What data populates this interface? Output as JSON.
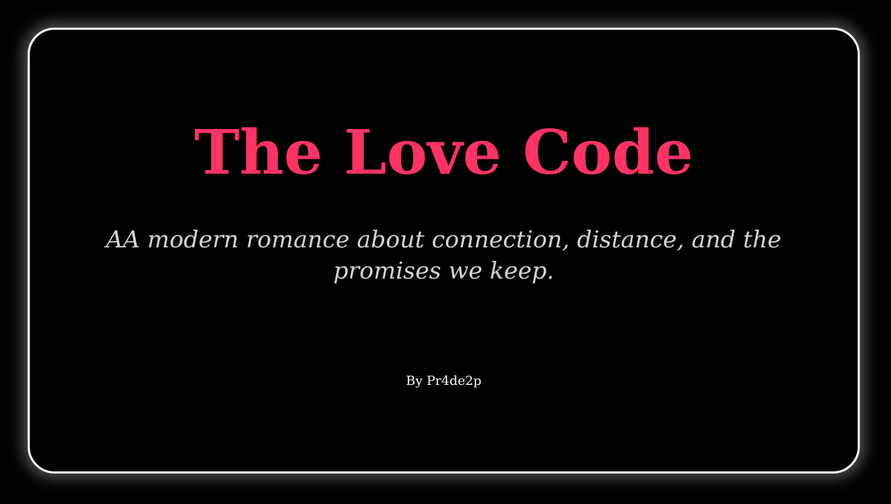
{
  "card": {
    "title": "The Love Code",
    "subtitle": "AA modern romance about connection, distance, and the promises we keep.",
    "byline": "By Pr4de2p"
  },
  "colors": {
    "background": "#000000",
    "card_border": "#ffffff",
    "title": "#ff3366",
    "subtitle": "#d4d4d4",
    "byline": "#ffffff"
  }
}
